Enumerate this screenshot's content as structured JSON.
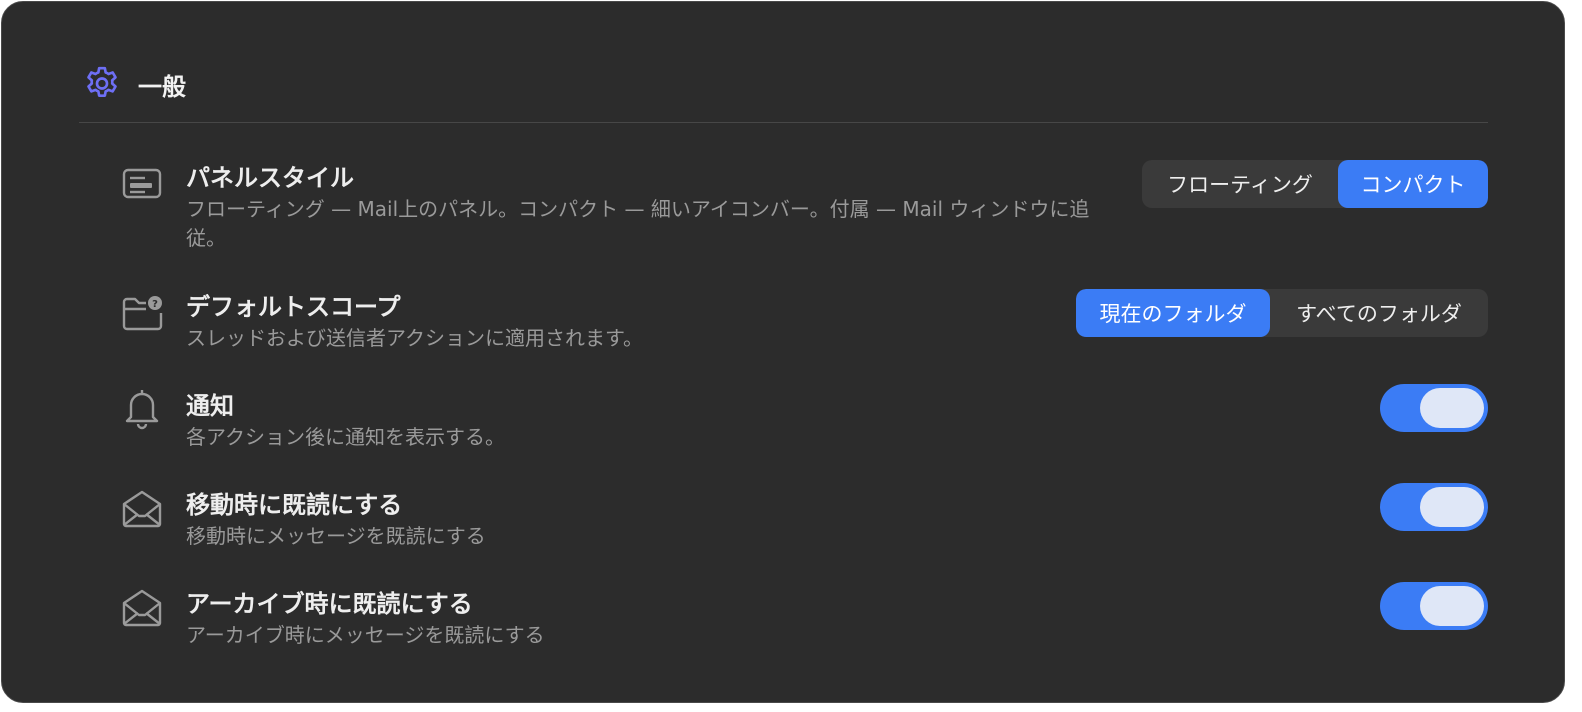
{
  "section": {
    "title": "一般",
    "icon": "gear-icon",
    "accent_color": "#6e6ff5"
  },
  "settings": [
    {
      "icon": "panel-layout-icon",
      "title": "パネルスタイル",
      "description": "フローティング — Mail上のパネル。コンパクト — 細いアイコンバー。付属 — Mail ウィンドウに追従。",
      "control": "segmented",
      "options": [
        "フローティング",
        "コンパクト"
      ],
      "selected": "コンパクト"
    },
    {
      "icon": "folder-question-icon",
      "title": "デフォルトスコープ",
      "description": "スレッドおよび送信者アクションに適用されます。",
      "control": "segmented",
      "options": [
        "現在のフォルダ",
        "すべてのフォルダ"
      ],
      "selected": "現在のフォルダ"
    },
    {
      "icon": "bell-icon",
      "title": "通知",
      "description": "各アクション後に通知を表示する。",
      "control": "toggle",
      "on": true
    },
    {
      "icon": "open-envelope-icon",
      "title": "移動時に既読にする",
      "description": "移動時にメッセージを既読にする",
      "control": "toggle",
      "on": true
    },
    {
      "icon": "open-envelope-icon",
      "title": "アーカイブ時に既読にする",
      "description": "アーカイブ時にメッセージを既読にする",
      "control": "toggle",
      "on": true
    }
  ],
  "colors": {
    "panel_background": "#2c2c2c",
    "toggle_on": "#3b7cf5",
    "segment_active": "#3b7cf5"
  }
}
